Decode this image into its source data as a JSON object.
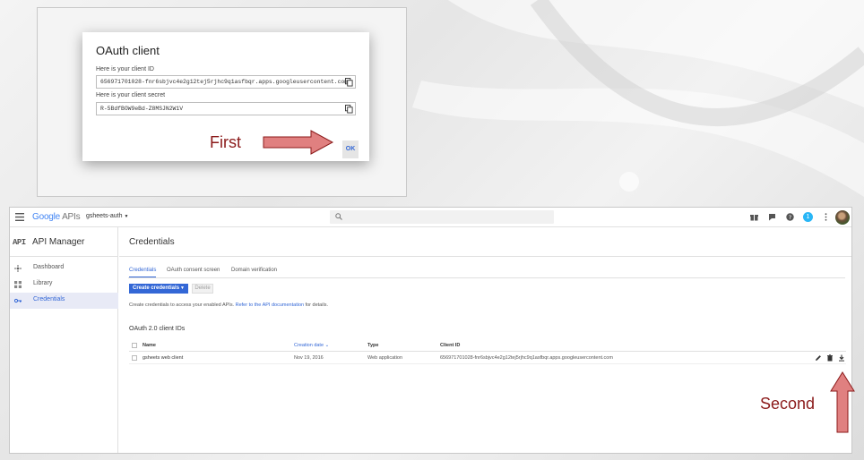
{
  "annotations": {
    "first_label": "First",
    "second_label": "Second",
    "arrow_color": "#e08080",
    "text_color": "#8b1a1a"
  },
  "oauth_dialog": {
    "title": "OAuth client",
    "client_id_label": "Here is your client ID",
    "client_id_value": "656971701028-fnr6sbjvc4e2g12tej5rjhc9q1asfbqr.apps.googleusercontent.com",
    "client_secret_label": "Here is your client secret",
    "client_secret_value": "R-5BdfBOW9eBd-Z8MSJN2W1V",
    "ok_label": "OK",
    "copy_icon": "copy-icon"
  },
  "topbar": {
    "logo_google": "Google",
    "logo_apis": "APIs",
    "project_name": "gsheets-auth",
    "notification_count": "1"
  },
  "sidebar": {
    "logo": "API",
    "title": "API Manager",
    "items": [
      {
        "label": "Dashboard",
        "icon": "dashboard-icon",
        "active": false
      },
      {
        "label": "Library",
        "icon": "library-icon",
        "active": false
      },
      {
        "label": "Credentials",
        "icon": "key-icon",
        "active": true
      }
    ]
  },
  "main": {
    "page_title": "Credentials",
    "tabs": [
      {
        "label": "Credentials",
        "active": true
      },
      {
        "label": "OAuth consent screen",
        "active": false
      },
      {
        "label": "Domain verification",
        "active": false
      }
    ],
    "create_button": "Create credentials",
    "delete_button": "Delete",
    "info_text": "Create credentials to access your enabled APIs.",
    "info_link": "Refer to the API documentation",
    "info_suffix": "for details.",
    "section_title": "OAuth 2.0 client IDs",
    "table": {
      "headers": [
        "Name",
        "Creation date",
        "Type",
        "Client ID"
      ],
      "sorted_column": "Creation date",
      "rows": [
        {
          "name": "gsheets web client",
          "date": "Nov 19, 2016",
          "type": "Web application",
          "client_id": "656971701028-fnr6sbjvc4e2g12tej5rjhc9q1asfbqr.apps.googleusercontent.com"
        }
      ]
    }
  },
  "colors": {
    "accent": "#3367d6",
    "active_nav_bg": "#e8eaf6"
  }
}
